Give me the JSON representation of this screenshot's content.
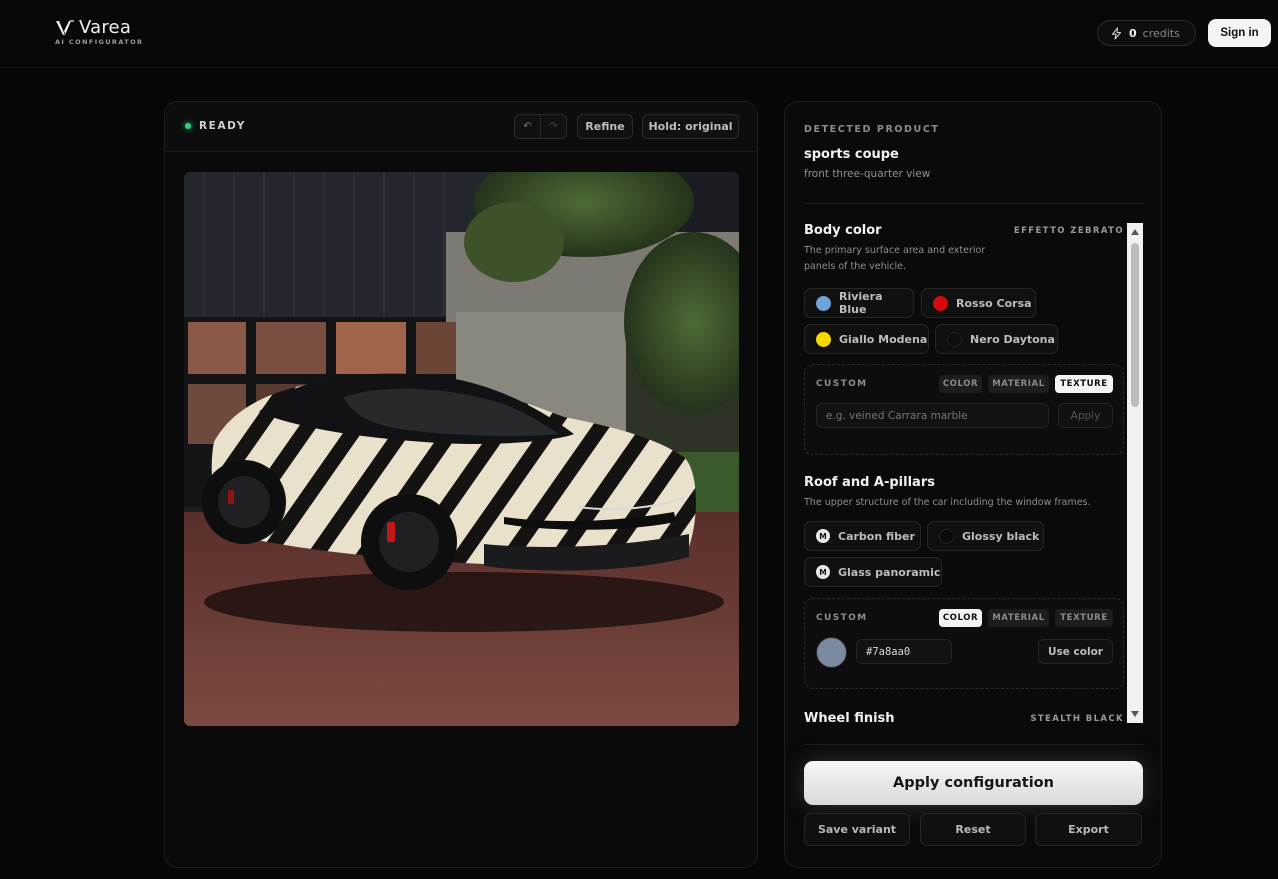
{
  "brand": {
    "name": "Varea",
    "subtitle": "AI CONFIGURATOR"
  },
  "header": {
    "credits_count": "0",
    "credits_label": "credits",
    "signin_label": "Sign in"
  },
  "preview": {
    "status": "READY",
    "refine_label": "Refine",
    "hold_label": "Hold: original",
    "undo_icon": "undo-icon",
    "redo_icon": "redo-icon"
  },
  "detected": {
    "label": "DETECTED PRODUCT",
    "product": "sports coupe",
    "view": "front three-quarter view"
  },
  "sections": {
    "body": {
      "title": "Body color",
      "tag": "EFFETTO ZEBRATO",
      "desc_line1": "The primary surface area and exterior",
      "desc_line2": "panels of the vehicle.",
      "options": [
        {
          "label": "Riviera Blue",
          "color": "#6fa2d6"
        },
        {
          "label": "Rosso Corsa",
          "color": "#d60a0a"
        },
        {
          "label": "Giallo Modena",
          "color": "#f5d800"
        },
        {
          "label": "Nero Daytona",
          "color": "#0e0e0e"
        }
      ],
      "custom": {
        "label": "CUSTOM",
        "tabs": [
          "COLOR",
          "MATERIAL",
          "TEXTURE"
        ],
        "active_tab": "TEXTURE",
        "placeholder": "e.g. veined Carrara marble",
        "apply_label": "Apply"
      }
    },
    "roof": {
      "title": "Roof and A-pillars",
      "desc": "The upper structure of the car including the window frames.",
      "options": [
        {
          "label": "Carbon fiber",
          "badge": "M"
        },
        {
          "label": "Glossy black",
          "color": "#0a0a0a"
        },
        {
          "label": "Glass panoramic",
          "badge": "M"
        }
      ],
      "custom": {
        "label": "CUSTOM",
        "tabs": [
          "COLOR",
          "MATERIAL",
          "TEXTURE"
        ],
        "active_tab": "COLOR",
        "hex_value": "#7a8aa0",
        "swatch_color": "#7a8aa0",
        "use_color_label": "Use color"
      }
    },
    "wheel": {
      "title": "Wheel finish",
      "tag": "STEALTH BLACK"
    }
  },
  "actions": {
    "apply_label": "Apply configuration",
    "save_label": "Save variant",
    "reset_label": "Reset",
    "export_label": "Export"
  }
}
